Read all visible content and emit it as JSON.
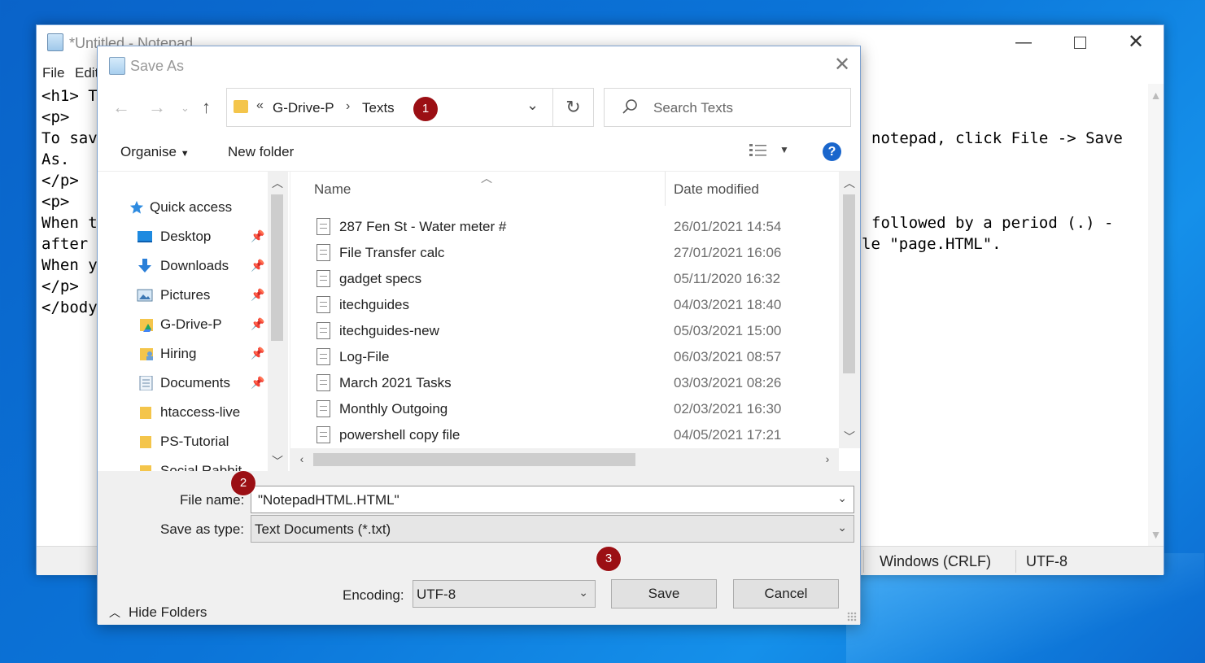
{
  "notepad": {
    "title": "*Untitled - Notepad",
    "menu": [
      "File",
      "Edit"
    ],
    "editor_left_lines": [
      "<h1> T",
      "<p>",
      "To sav",
      "As.",
      "</p>",
      "<p>",
      "When t",
      "after",
      "When y",
      "</p>",
      "</body"
    ],
    "editor_right_lines": [
      "notepad, click File -> Save",
      "",
      "",
      "",
      "followed by a period (.) -",
      "le \"page.HTML\"."
    ],
    "status": {
      "line_ending": "Windows (CRLF)",
      "encoding": "UTF-8"
    }
  },
  "dialog": {
    "title": "Save As",
    "address": {
      "overflow": "«",
      "crumbs": [
        "G-Drive-P",
        "Texts"
      ]
    },
    "search_placeholder": "Search Texts",
    "toolbar": {
      "organise": "Organise",
      "new_folder": "New folder",
      "help": "?"
    },
    "nav_items": [
      {
        "label": "Quick access",
        "icon": "star-icon",
        "pinned": false
      },
      {
        "label": "Desktop",
        "icon": "desktop-icon",
        "pinned": true
      },
      {
        "label": "Downloads",
        "icon": "download-icon",
        "pinned": true
      },
      {
        "label": "Pictures",
        "icon": "pictures-icon",
        "pinned": true
      },
      {
        "label": "G-Drive-P",
        "icon": "gdrive-folder-icon",
        "pinned": true
      },
      {
        "label": "Hiring",
        "icon": "user-folder-icon",
        "pinned": true
      },
      {
        "label": "Documents",
        "icon": "documents-icon",
        "pinned": true
      },
      {
        "label": "htaccess-live",
        "icon": "folder-icon",
        "pinned": false
      },
      {
        "label": "PS-Tutorial",
        "icon": "folder-icon",
        "pinned": false
      },
      {
        "label": "Social Rabbit",
        "icon": "folder-icon",
        "pinned": false
      }
    ],
    "columns": {
      "name": "Name",
      "date": "Date modified"
    },
    "files": [
      {
        "name": "287 Fen St - Water meter #",
        "date": "26/01/2021 14:54"
      },
      {
        "name": "File Transfer calc",
        "date": "27/01/2021 16:06"
      },
      {
        "name": "gadget specs",
        "date": "05/11/2020 16:32"
      },
      {
        "name": "itechguides",
        "date": "04/03/2021 18:40"
      },
      {
        "name": "itechguides-new",
        "date": "05/03/2021 15:00"
      },
      {
        "name": "Log-File",
        "date": "06/03/2021 08:57"
      },
      {
        "name": "March 2021 Tasks",
        "date": "03/03/2021 08:26"
      },
      {
        "name": "Monthly Outgoing",
        "date": "02/03/2021 16:30"
      },
      {
        "name": "powershell copy file",
        "date": "04/05/2021 17:21"
      }
    ],
    "file_name_label": "File name:",
    "file_name_value": "\"NotepadHTML.HTML\"",
    "save_as_type_label": "Save as type:",
    "save_as_type_value": "Text Documents (*.txt)",
    "encoding_label": "Encoding:",
    "encoding_value": "UTF-8",
    "save_label": "Save",
    "cancel_label": "Cancel",
    "hide_folders_label": "Hide Folders"
  },
  "badges": [
    "1",
    "2",
    "3"
  ],
  "colors": {
    "badge": "#9b0f14",
    "help": "#1a66cc",
    "desktop_bg": "#0b74d8"
  }
}
